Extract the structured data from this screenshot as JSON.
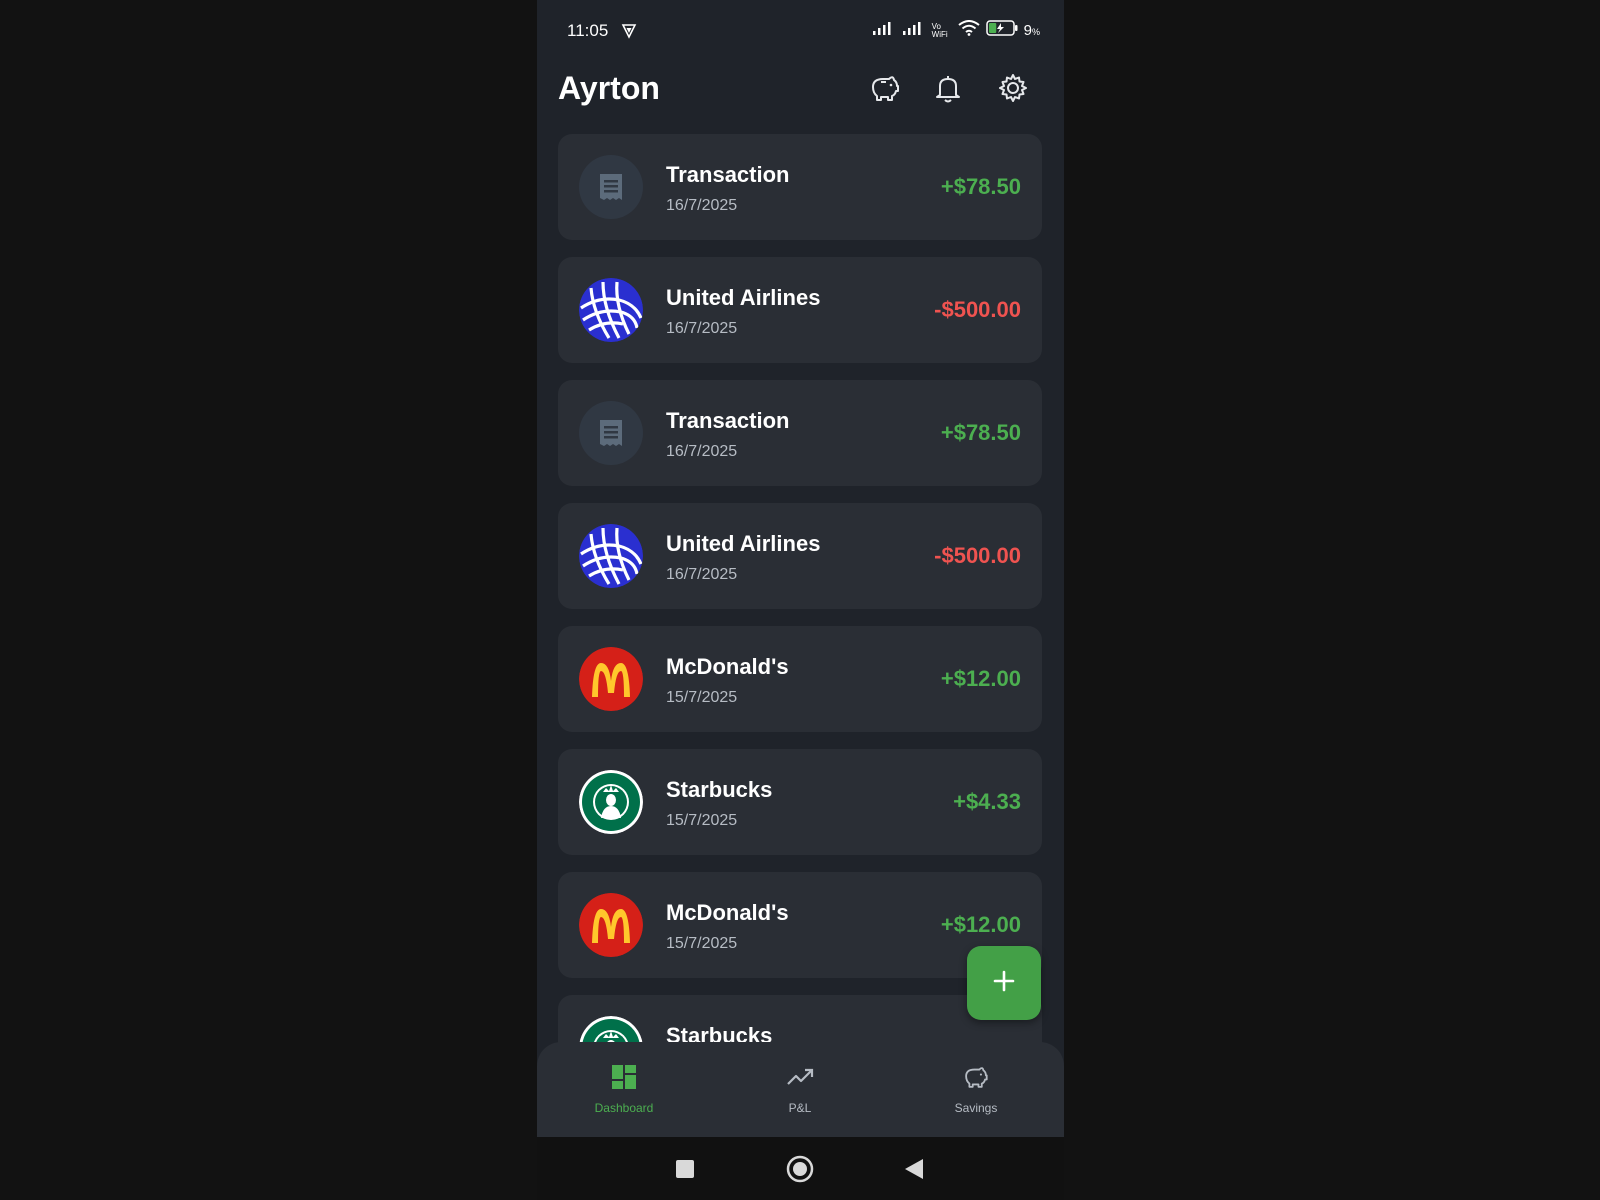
{
  "status_bar": {
    "time": "11:05",
    "vowifi_top": "Vo",
    "vowifi_bottom": "WiFi",
    "battery_percent": "9",
    "battery_unit": "%",
    "battery_level": 0.09
  },
  "header": {
    "title": "Ayrton",
    "icons": [
      "piggy-bank-icon",
      "bell-icon",
      "gear-icon"
    ]
  },
  "transactions": [
    {
      "name": "Transaction",
      "date": "16/7/2025",
      "amount": "+$78.50",
      "type": "positive",
      "logo": "receipt-icon"
    },
    {
      "name": "United Airlines",
      "date": "16/7/2025",
      "amount": "-$500.00",
      "type": "negative",
      "logo": "united-airlines-logo"
    },
    {
      "name": "Transaction",
      "date": "16/7/2025",
      "amount": "+$78.50",
      "type": "positive",
      "logo": "receipt-icon"
    },
    {
      "name": "United Airlines",
      "date": "16/7/2025",
      "amount": "-$500.00",
      "type": "negative",
      "logo": "united-airlines-logo"
    },
    {
      "name": "McDonald's",
      "date": "15/7/2025",
      "amount": "+$12.00",
      "type": "positive",
      "logo": "mcdonalds-logo"
    },
    {
      "name": "Starbucks",
      "date": "15/7/2025",
      "amount": "+$4.33",
      "type": "positive",
      "logo": "starbucks-logo"
    },
    {
      "name": "McDonald's",
      "date": "15/7/2025",
      "amount": "+$12.00",
      "type": "positive",
      "logo": "mcdonalds-logo"
    },
    {
      "name": "Starbucks",
      "date": "",
      "amount": "",
      "type": "positive",
      "logo": "starbucks-logo"
    }
  ],
  "fab": {
    "icon": "plus-icon"
  },
  "bottom_nav": {
    "items": [
      {
        "label": "Dashboard",
        "icon": "dashboard-icon",
        "active": true
      },
      {
        "label": "P&L",
        "icon": "trending-up-icon",
        "active": false
      },
      {
        "label": "Savings",
        "icon": "piggy-bank-icon",
        "active": false
      }
    ]
  },
  "colors": {
    "positive": "#4caf50",
    "negative": "#ef5350",
    "accent": "#43a047",
    "card": "#2a2e35",
    "background": "#1f232a"
  }
}
